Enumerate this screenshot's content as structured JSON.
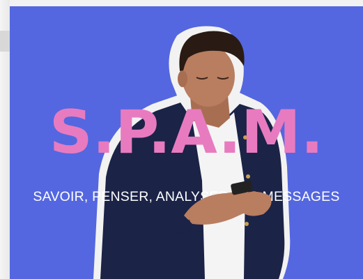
{
  "banner": {
    "title": "S.P.A.M.",
    "subtitle": "SAVOIR, PENSER, ANALYSER LES MESSAGES"
  },
  "colors": {
    "background": "#5467e0",
    "title": "#e87bc0",
    "subtitle": "#ffffff",
    "jacket": "#1b2347",
    "shirt": "#f4f4f4",
    "skin": "#b97d60",
    "hair": "#2a1a14"
  }
}
